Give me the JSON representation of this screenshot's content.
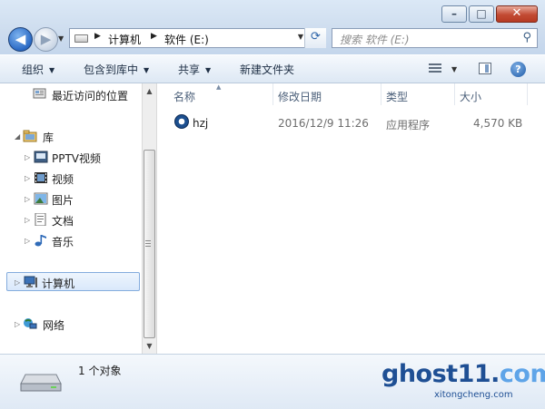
{
  "address_bar": {
    "crumbs": [
      "计算机",
      "软件 (E:)"
    ],
    "search_placeholder": "搜索 软件 (E:)"
  },
  "toolbar": {
    "organize": "组织",
    "include_in_library": "包含到库中",
    "share": "共享",
    "new_folder": "新建文件夹",
    "help": "?"
  },
  "nav_pane": {
    "recent": "最近访问的位置",
    "libraries": "库",
    "library_items": [
      "PPTV视频",
      "视频",
      "图片",
      "文档",
      "音乐"
    ],
    "computer": "计算机",
    "network": "网络"
  },
  "file_list": {
    "columns": [
      "名称",
      "修改日期",
      "类型",
      "大小"
    ],
    "rows": [
      {
        "name": "hzj",
        "modified": "2016/12/9 11:26",
        "type": "应用程序",
        "size": "4,570 KB"
      }
    ]
  },
  "details_pane": {
    "count": "1 个对象"
  },
  "watermark": {
    "main": "ghost11.",
    "tail": "com",
    "sub": "xitongcheng.com"
  }
}
